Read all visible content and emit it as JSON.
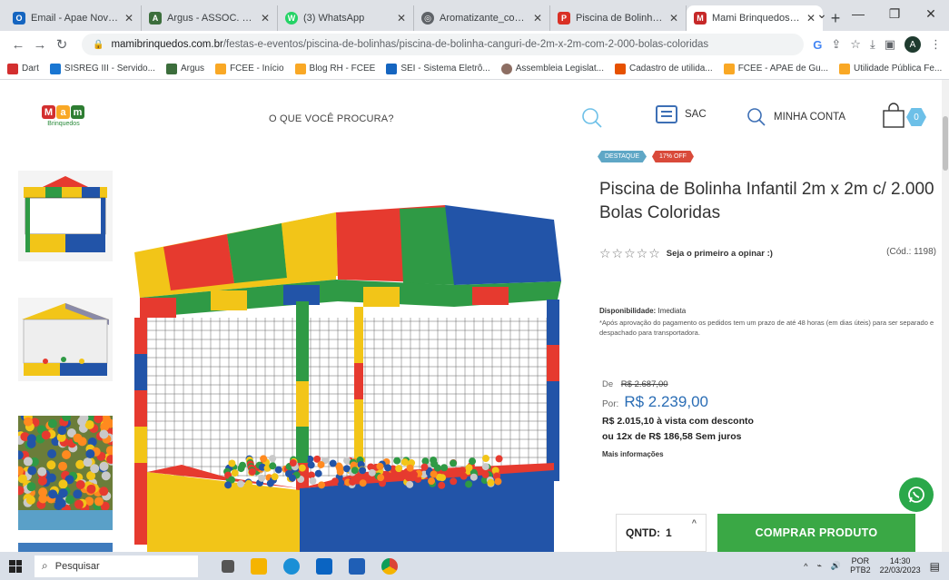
{
  "browser": {
    "tabs": [
      {
        "title": "Email - Apae Nova Tr...",
        "color": "#1565c0",
        "glyph": "O",
        "active": false
      },
      {
        "title": "Argus - ASSOC. DE PA...",
        "color": "#3c6e3c",
        "glyph": "A",
        "active": false
      },
      {
        "title": "(3) WhatsApp",
        "color": "#25d366",
        "glyph": "W",
        "active": false
      },
      {
        "title": "Aromatizante_compr...",
        "color": "#5f6368",
        "glyph": "◎",
        "active": false
      },
      {
        "title": "Piscina de Bolinha de...",
        "color": "#d93025",
        "glyph": "P",
        "active": false
      },
      {
        "title": "Mami Brinquedos - P...",
        "color": "#c62828",
        "glyph": "M",
        "active": true
      }
    ],
    "new_tab": "+",
    "url_host": "mamibrinquedos.com.br",
    "url_path": "/festas-e-eventos/piscina-de-bolinhas/piscina-de-bolinha-canguri-de-2m-x-2m-com-2-000-bolas-coloridas",
    "profile_initial": "A",
    "bookmarks": [
      {
        "label": "Dart",
        "color": "#d32f2f"
      },
      {
        "label": "SISREG III - Servido...",
        "color": "#1976d2"
      },
      {
        "label": "Argus",
        "color": "#3c6e3c"
      },
      {
        "label": "FCEE - Início",
        "color": "#f9a825"
      },
      {
        "label": "Blog RH - FCEE",
        "color": "#f9a825"
      },
      {
        "label": "SEI - Sistema Eletrô...",
        "color": "#1565c0"
      },
      {
        "label": "Assembleia Legislat...",
        "color": "#8d6e63"
      },
      {
        "label": "Cadastro de utilida...",
        "color": "#e65100"
      },
      {
        "label": "FCEE - APAE de Gu...",
        "color": "#f9a825"
      },
      {
        "label": "Utilidade Pública Fe...",
        "color": "#f9a825"
      }
    ],
    "bookmarks_more": "»"
  },
  "site": {
    "logo_letters": [
      "M",
      "a",
      "m",
      "i"
    ],
    "logo_sub": "Brinquedos",
    "search_placeholder": "O QUE VOCÊ PROCURA?",
    "sac_label": "SAC",
    "account_label": "MINHA CONTA",
    "cart_count": "0"
  },
  "product": {
    "badge_highlight": "DESTAQUE",
    "badge_discount": "17% OFF",
    "title": "Piscina de Bolinha Infantil 2m x 2m c/ 2.000 Bolas Coloridas",
    "stars": "☆☆☆☆☆",
    "rating_cta": "Seja o primeiro a opinar :)",
    "code": "(Cód.: 1198)",
    "availability_label": "Disponibilidade:",
    "availability_value": "Imediata",
    "availability_note": "*Após aprovação do pagamento os pedidos tem um prazo de até 48 horas (em dias úteis) para ser separado e despachado para transportadora.",
    "from_label": "De",
    "old_price": "R$ 2.687,00",
    "by_label": "Por:",
    "price": "R$ 2.239,00",
    "cash_price": "R$ 2.015,10 à vista com desconto",
    "installments": "ou 12x de R$ 186,58 Sem juros",
    "more_info": "Mais informações",
    "qty_label": "QNTD:",
    "qty_value": "1",
    "buy_label": "COMPRAR PRODUTO"
  },
  "taskbar": {
    "search_placeholder": "Pesquisar",
    "lang_top": "POR",
    "lang_bottom": "PTB2",
    "time": "14:30",
    "date": "22/03/2023"
  },
  "colors": {
    "accent_blue": "#2a6db5",
    "buy_green": "#3aa845",
    "badge_blue": "#5fa7c6",
    "badge_red": "#d94a3a"
  }
}
